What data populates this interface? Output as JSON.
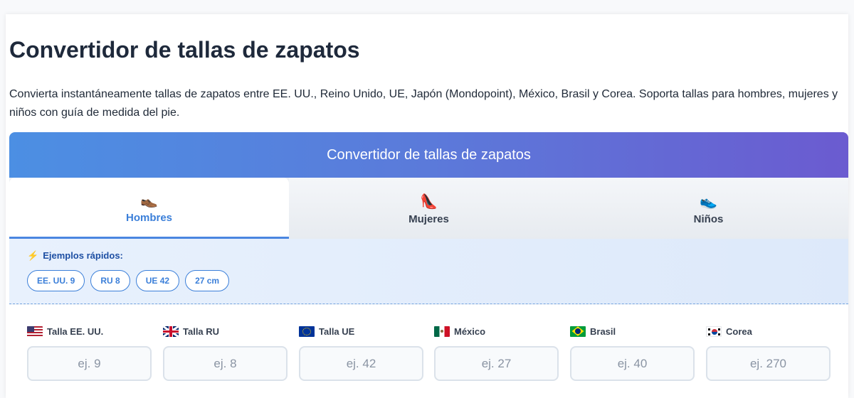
{
  "page": {
    "title": "Convertidor de tallas de zapatos",
    "intro": "Convierta instantáneamente tallas de zapatos entre EE. UU., Reino Unido, UE, Japón (Mondopoint), México, Brasil y Corea. Soporta tallas para hombres, mujeres y niños con guía de medida del pie."
  },
  "widget": {
    "header": "Convertidor de tallas de zapatos",
    "tabs": [
      {
        "label": "Hombres",
        "emoji": "👞",
        "icon": "mens-shoe-icon",
        "active": true
      },
      {
        "label": "Mujeres",
        "emoji": "👠",
        "icon": "high-heel-icon",
        "active": false
      },
      {
        "label": "Niños",
        "emoji": "👟",
        "icon": "sneaker-icon",
        "active": false
      }
    ],
    "quick_examples": {
      "icon": "lightning-icon",
      "title": "Ejemplos rápidos:",
      "chips": [
        "EE. UU. 9",
        "RU 8",
        "UE 42",
        "27 cm"
      ]
    },
    "fields": [
      {
        "label": "Talla EE. UU.",
        "placeholder": "ej. 9",
        "flag": "us-flag-icon"
      },
      {
        "label": "Talla RU",
        "placeholder": "ej. 8",
        "flag": "uk-flag-icon"
      },
      {
        "label": "Talla UE",
        "placeholder": "ej. 42",
        "flag": "eu-flag-icon"
      },
      {
        "label": "México",
        "placeholder": "ej. 27",
        "flag": "mexico-flag-icon"
      },
      {
        "label": "Brasil",
        "placeholder": "ej. 40",
        "flag": "brazil-flag-icon"
      },
      {
        "label": "Corea",
        "placeholder": "ej. 270",
        "flag": "korea-flag-icon"
      }
    ]
  },
  "colors": {
    "accent": "#3b7fd9",
    "header_gradient_start": "#4c8fe3",
    "header_gradient_end": "#6b5bd0",
    "title": "#1e293b"
  }
}
